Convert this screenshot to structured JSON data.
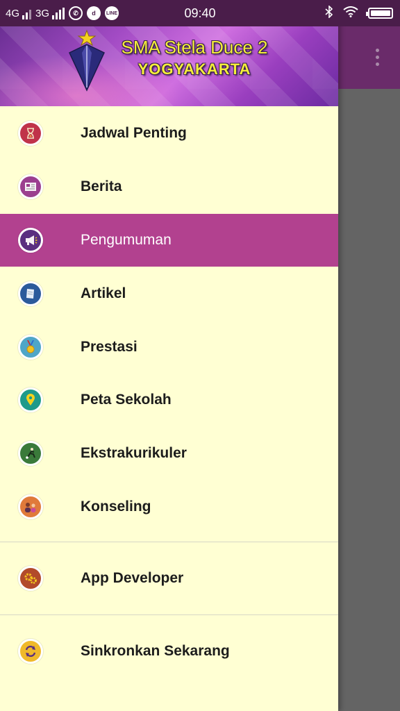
{
  "status_bar": {
    "network1": "4G",
    "network2": "3G",
    "time": "09:40"
  },
  "header": {
    "title_line1": "SMA Stela Duce 2",
    "title_line2": "YOGYAKARTA"
  },
  "menu": {
    "items": [
      {
        "label": "Jadwal Penting",
        "icon": "hourglass-icon",
        "color": "#c0334a"
      },
      {
        "label": "Berita",
        "icon": "newspaper-icon",
        "color": "#9b3f8f"
      },
      {
        "label": "Pengumuman",
        "icon": "megaphone-icon",
        "color": "#7b3f8f",
        "active": true
      },
      {
        "label": "Artikel",
        "icon": "article-icon",
        "color": "#2b5a9b"
      },
      {
        "label": "Prestasi",
        "icon": "medal-icon",
        "color": "#4fa6c8"
      },
      {
        "label": "Peta Sekolah",
        "icon": "map-pin-icon",
        "color": "#1f9a8a"
      },
      {
        "label": "Ekstrakurikuler",
        "icon": "sports-icon",
        "color": "#3a7a3a"
      },
      {
        "label": "Konseling",
        "icon": "people-icon",
        "color": "#e07a3a"
      }
    ],
    "secondary": [
      {
        "label": "App Developer",
        "icon": "gears-icon",
        "color": "#b24a2a"
      },
      {
        "label": "Sinkronkan Sekarang",
        "icon": "sync-icon",
        "color": "#f0b92a"
      }
    ]
  },
  "colors": {
    "drawer_bg": "#ffffd3",
    "active_bg": "#b2418f",
    "status_bar": "#4a1d4a",
    "app_bar": "#6a2b6a"
  }
}
